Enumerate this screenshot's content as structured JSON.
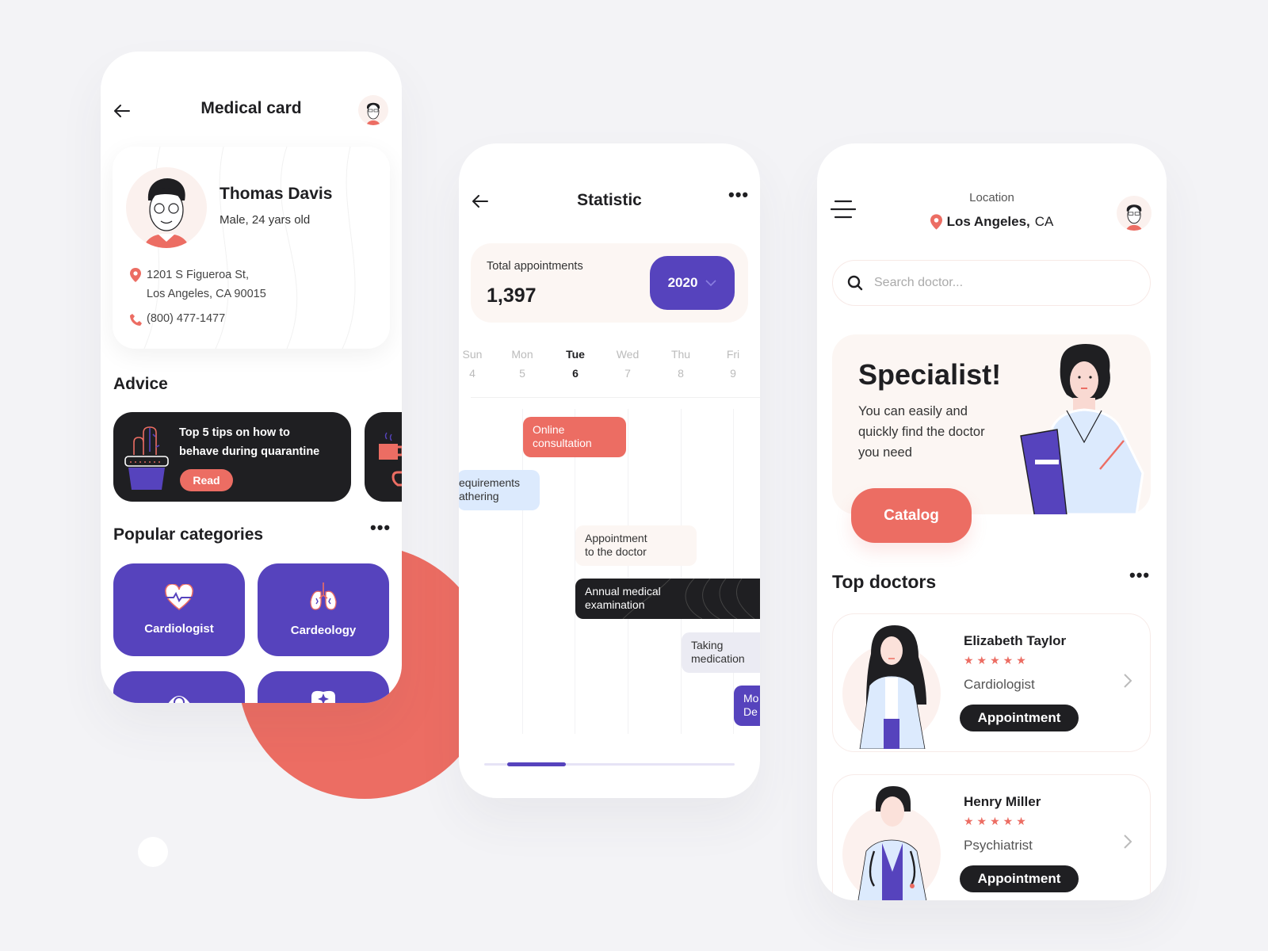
{
  "colors": {
    "accent": "#5643bd",
    "coral": "#ec6d63",
    "dark": "#1f1f22",
    "cream": "#fcf6f3",
    "light_blue": "#dceafd",
    "light_gray": "#ebebf3"
  },
  "medical_card": {
    "title": "Medical card",
    "back_icon": "arrow-left-icon",
    "profile": {
      "name": "Thomas Davis",
      "subtitle": "Male, 24 yars old",
      "address_line1": "1201 S Figueroa St,",
      "address_line2": "Los Angeles, CA 90015",
      "phone": "(800) 477-1477"
    },
    "advice": {
      "title": "Advice",
      "cards": [
        {
          "text_line1": "Top 5 tips on how to",
          "text_line2": "behave during quarantine",
          "button": "Read",
          "icon": "cactus-icon"
        },
        {
          "icon": "coffee-cup-icon"
        }
      ]
    },
    "categories": {
      "title": "Popular categories",
      "more": "•••",
      "items": [
        {
          "label": "Cardiologist",
          "icon": "heart-pulse-icon"
        },
        {
          "label": "Cardeology",
          "icon": "lungs-icon"
        },
        {
          "label": "",
          "icon": "eye-icon"
        },
        {
          "label": "",
          "icon": "tooth-icon"
        }
      ]
    }
  },
  "statistic": {
    "title": "Statistic",
    "more": "•••",
    "total_label": "Total appointments",
    "total_value": "1,397",
    "year": "2020",
    "days": [
      {
        "name": "Sun",
        "num": "4"
      },
      {
        "name": "Mon",
        "num": "5"
      },
      {
        "name": "Tue",
        "num": "6",
        "active": true
      },
      {
        "name": "Wed",
        "num": "7"
      },
      {
        "name": "Thu",
        "num": "8"
      },
      {
        "name": "Fri",
        "num": "9"
      }
    ],
    "events": [
      {
        "line1": "Online",
        "line2": "consultation"
      },
      {
        "line1": "equirements",
        "line2": "athering"
      },
      {
        "line1": "Appointment",
        "line2": "to the doctor"
      },
      {
        "line1": "Annual medical",
        "line2": "examination"
      },
      {
        "line1": "Taking",
        "line2": "medication"
      },
      {
        "line1": "Mo",
        "line2": "De"
      }
    ],
    "scroll_position": 0.12
  },
  "find_doctor": {
    "location_label": "Location",
    "location_city": "Los Angeles,",
    "location_state": "CA",
    "search_placeholder": "Search doctor...",
    "promo": {
      "title": "Specialist!",
      "text": "You can easily and quickly find the doctor you need",
      "button": "Catalog"
    },
    "top_doctors": {
      "title": "Top doctors",
      "more": "•••",
      "items": [
        {
          "name": "Elizabeth Taylor",
          "rating": 5,
          "stars": "★★★★★",
          "specialty": "Cardiologist",
          "button": "Appointment"
        },
        {
          "name": "Henry Miller",
          "rating": 5,
          "stars": "★★★★★",
          "specialty": "Psychiatrist",
          "button": "Appointment"
        }
      ]
    }
  }
}
